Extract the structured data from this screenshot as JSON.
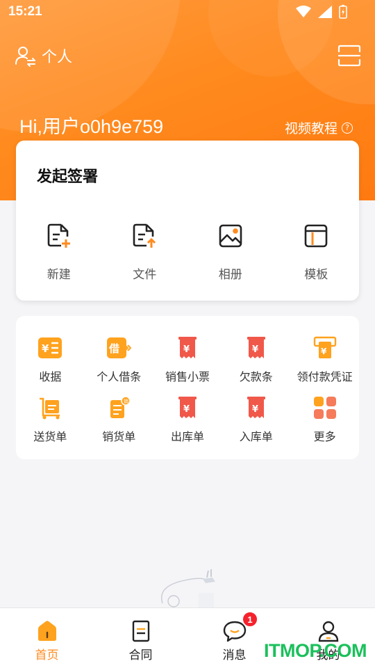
{
  "status_bar": {
    "time": "15:21"
  },
  "header": {
    "profile_label": "个人",
    "greeting": "Hi,用户o0h9e759",
    "tutorial_label": "视频教程",
    "help_glyph": "?"
  },
  "sign_card": {
    "title": "发起签署",
    "items": [
      {
        "label": "新建",
        "icon": "new-document-icon"
      },
      {
        "label": "文件",
        "icon": "upload-file-icon"
      },
      {
        "label": "相册",
        "icon": "photo-album-icon"
      },
      {
        "label": "模板",
        "icon": "template-icon"
      }
    ]
  },
  "tools": {
    "items": [
      {
        "label": "收据",
        "icon": "receipt-icon"
      },
      {
        "label": "个人借条",
        "icon": "iou-icon"
      },
      {
        "label": "销售小票",
        "icon": "sales-ticket-icon"
      },
      {
        "label": "欠款条",
        "icon": "debt-note-icon"
      },
      {
        "label": "领付款凭证",
        "icon": "payment-voucher-icon"
      },
      {
        "label": "送货单",
        "icon": "delivery-note-icon"
      },
      {
        "label": "销货单",
        "icon": "sales-order-icon"
      },
      {
        "label": "出库单",
        "icon": "outbound-order-icon"
      },
      {
        "label": "入库单",
        "icon": "inbound-order-icon"
      },
      {
        "label": "更多",
        "icon": "more-grid-icon"
      }
    ]
  },
  "bottom_nav": {
    "items": [
      {
        "label": "首页",
        "icon": "home-icon",
        "active": true
      },
      {
        "label": "合同",
        "icon": "contract-icon"
      },
      {
        "label": "消息",
        "icon": "message-icon",
        "badge": "1"
      },
      {
        "label": "我的",
        "icon": "user-icon"
      }
    ]
  },
  "watermark": "ITMOP.COM",
  "colors": {
    "brand_orange": "#ff8a1e",
    "badge_red": "#f5222d",
    "ticket_red": "#f0584a",
    "watermark_green": "#1bc05b"
  }
}
